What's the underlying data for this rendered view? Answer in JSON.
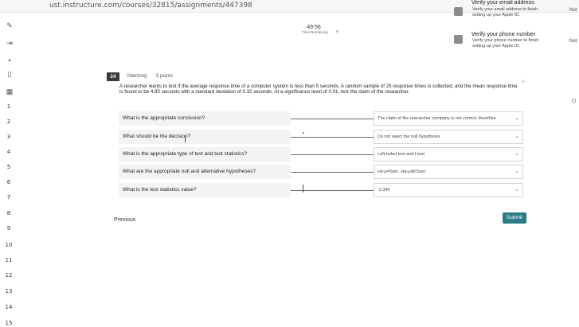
{
  "browser": {
    "url": "ust.instructure.com/courses/32815/assignments/447398"
  },
  "notifications": [
    {
      "title": "Verify your email address",
      "body_lines": [
        "Verify your email address to finish",
        "setting up your Apple ID."
      ],
      "action": "Not"
    },
    {
      "title": "Verify your phone number",
      "body_lines": [
        "Verify your phone number to finish",
        "setting up your Apple ID."
      ],
      "action": "Not"
    }
  ],
  "timer": {
    "value": "49:56",
    "label": "Time Remaining"
  },
  "question_numbers": [
    "1",
    "2",
    "3",
    "4",
    "5",
    "6",
    "7",
    "8",
    "9",
    "10",
    "11",
    "12",
    "13",
    "14",
    "15"
  ],
  "question": {
    "number": "24",
    "type": "Matching",
    "points": "5 points",
    "text": "A researcher wants to test if the average response time of a computer system is less than 5 seconds. A random sample of 25 response times is collected, and the mean response time is found to be 4.85 seconds with a standard deviation of 0.32 seconds. At a significance level of 0.01, test the claim of the researcher."
  },
  "matches": [
    {
      "prompt": "What is the appropriate conclusion?",
      "answer": "The claim of the researcher company is not correct; therefore"
    },
    {
      "prompt": "What should be the decision?",
      "answer": "Do not reject the null hypothesis."
    },
    {
      "prompt": "What is the appropriate type of test and test statistics?",
      "answer": "Left-tailed test and t-test"
    },
    {
      "prompt": "What are the appropriate null and alternative hypotheses?",
      "answer": "Ho:μ=5sec ,Ha:μ&lt;5sec"
    },
    {
      "prompt": "What is the test statistics value?",
      "answer": "-2.344"
    }
  ],
  "footer": {
    "previous_label": "Previous",
    "submit_label": "Submit"
  },
  "right_edge_text": "O",
  "colors": {
    "submit": "#2a7d84",
    "badge": "#3a3a3a"
  }
}
